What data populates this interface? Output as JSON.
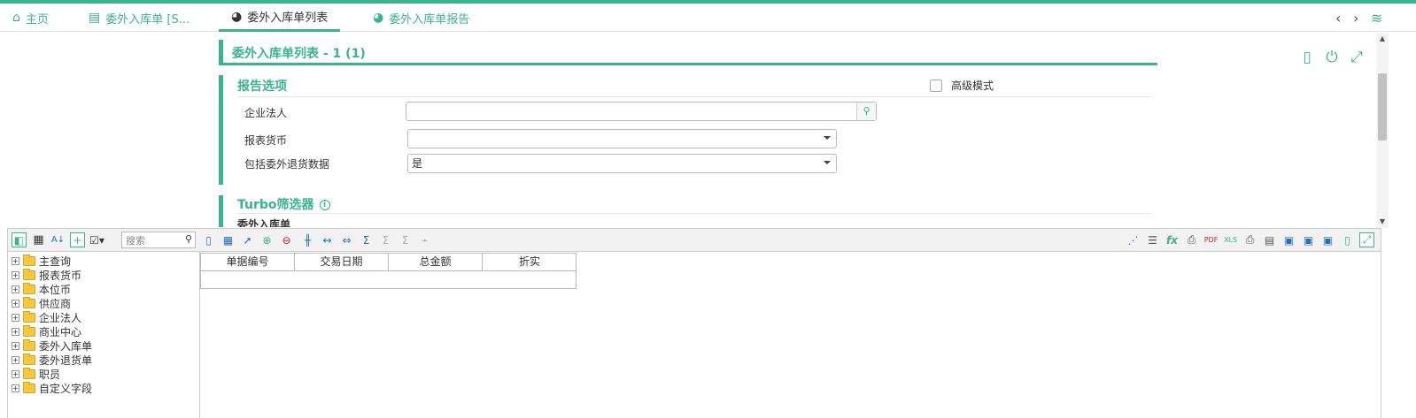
{
  "tabs": [
    {
      "label": "主页",
      "icon": "home-icon"
    },
    {
      "label": "委外入库单 [S...",
      "icon": "edit-document-icon"
    },
    {
      "label": "委外入库单列表",
      "icon": "pie-chart-icon"
    },
    {
      "label": "委外入库单报告",
      "icon": "pie-chart-icon"
    }
  ],
  "page": {
    "title": "委外入库单列表 - 1 (1)"
  },
  "report_options": {
    "title": "报告选项",
    "advanced_mode_label": "高级模式",
    "advanced_mode_checked": false,
    "fields": {
      "legal_entity": {
        "label": "企业法人",
        "value": ""
      },
      "report_currency": {
        "label": "报表货币",
        "value": ""
      },
      "include_return": {
        "label": "包括委外退货数据",
        "value": "是"
      }
    }
  },
  "turbo": {
    "title": "Turbo筛选器",
    "subtitle": "委外入库单"
  },
  "toolbar": {
    "search_placeholder": "搜索"
  },
  "tree": [
    {
      "label": "主查询"
    },
    {
      "label": "报表货币"
    },
    {
      "label": "本位币"
    },
    {
      "label": "供应商"
    },
    {
      "label": "企业法人"
    },
    {
      "label": "商业中心"
    },
    {
      "label": "委外入库单"
    },
    {
      "label": "委外退货单"
    },
    {
      "label": "职员"
    },
    {
      "label": "自定义字段"
    }
  ],
  "grid": {
    "columns": [
      "单据编号",
      "交易日期",
      "总金额",
      "折实"
    ]
  },
  "colors": {
    "accent": "#3cb38f"
  }
}
